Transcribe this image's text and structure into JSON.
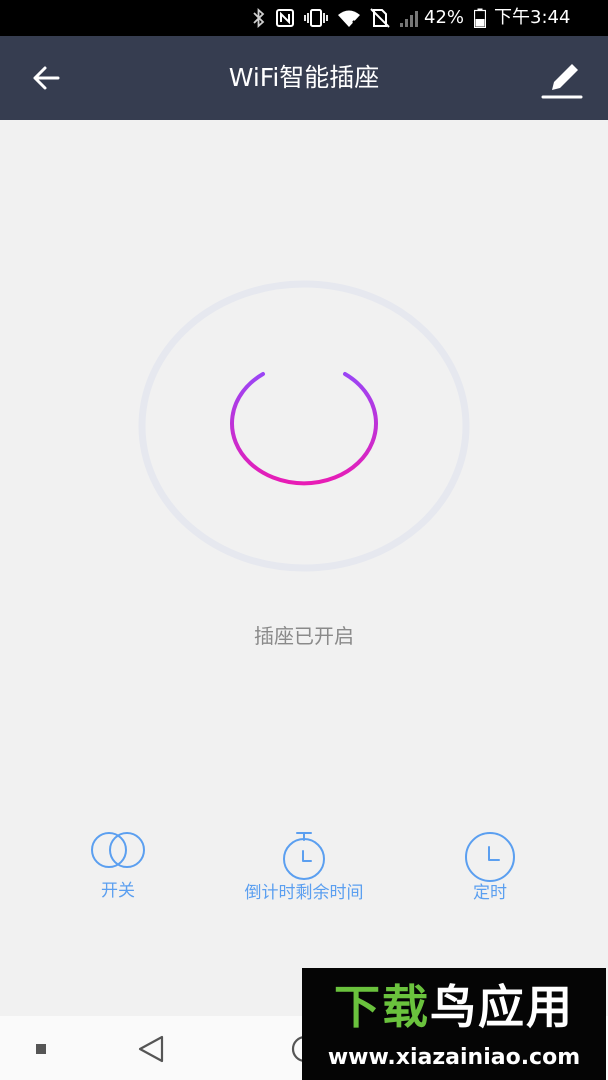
{
  "status_bar": {
    "battery": "42%",
    "time": "下午3:44",
    "icons": [
      "bluetooth-icon",
      "nfc-icon",
      "vibrate-icon",
      "wifi-icon",
      "no-sim-icon",
      "signal-icon",
      "battery-icon"
    ]
  },
  "app_bar": {
    "title": "WiFi智能插座",
    "back_icon": "arrow-left-icon",
    "edit_icon": "pencil-icon",
    "background": "#363d50"
  },
  "power": {
    "status_text": "插座已开启",
    "gradient_start": "#9b45f5",
    "gradient_end": "#e81cb5",
    "ring_color": "#e6e8ef"
  },
  "actions": [
    {
      "label": "开关",
      "icon": "toggle-circles-icon"
    },
    {
      "label": "倒计时剩余时间",
      "icon": "stopwatch-icon"
    },
    {
      "label": "定时",
      "icon": "clock-icon"
    }
  ],
  "accent_color": "#5b9ff0",
  "nav_bar": {
    "icons": [
      "recents-icon",
      "back-triangle-icon",
      "home-circle-icon"
    ]
  },
  "watermark": {
    "brand_first": "下载",
    "brand_rest": "鸟应用",
    "url": "www.xiazainiao.com"
  }
}
